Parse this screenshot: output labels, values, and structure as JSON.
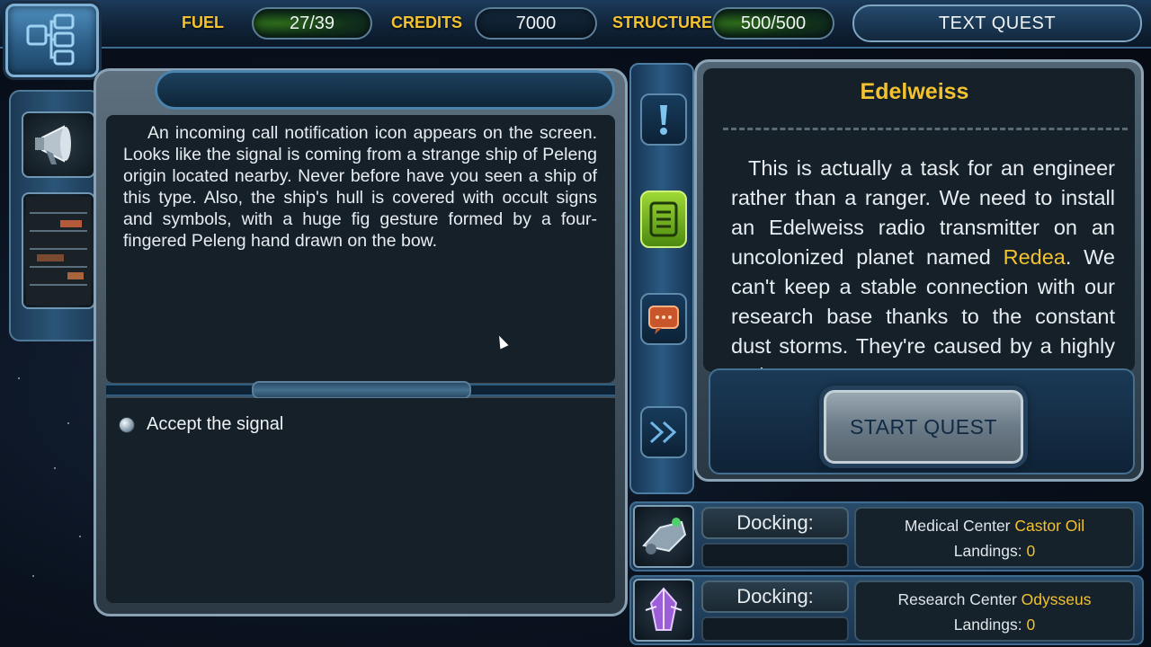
{
  "hud": {
    "fuel_label": "FUEL",
    "fuel_value": "27/39",
    "credits_label": "CREDITS",
    "credits_value": "7000",
    "structure_label": "STRUCTURE",
    "structure_value": "500/500",
    "mode_title": "TEXT QUEST"
  },
  "story": {
    "text": "An incoming call notification icon appears on the screen. Looks like the signal is coming from a strange ship of Peleng origin located nearby. Never before have you seen a ship of this type. Also, the ship's hull is covered with occult signs and symbols, with a huge fig gesture formed by a four-fingered Peleng hand drawn on the bow."
  },
  "choices": [
    {
      "label": "Accept the signal"
    }
  ],
  "quest": {
    "name": "Edelweiss",
    "body_part1": "This is actually a task for an engineer rather than a ranger. We need to install an Edelweiss radio transmitter on an uncolonized planet named ",
    "body_highlight": "Redea",
    "body_part2": ". We can't keep a stable connection with our research base thanks to the constant dust storms. They're caused by a highly active star",
    "start_label": "START QUEST"
  },
  "docking": [
    {
      "label": "Docking:",
      "station_type": "Medical Center",
      "station_name": "Castor Oil",
      "landings_label": "Landings:",
      "landings_value": "0"
    },
    {
      "label": "Docking:",
      "station_type": "Research Center",
      "station_name": "Odysseus",
      "landings_label": "Landings:",
      "landings_value": "0"
    }
  ],
  "colors": {
    "accent_gold": "#f2c230",
    "panel_dark": "#152028",
    "frame_blue": "#2a5a82",
    "tab_green": "#9ed836"
  },
  "icons": [
    "network-map-icon",
    "megaphone-icon",
    "circuit-board-icon",
    "exclamation-icon",
    "notes-icon",
    "chat-bubble-icon",
    "fast-forward-icon",
    "station-ship-icon",
    "crystal-station-icon"
  ]
}
